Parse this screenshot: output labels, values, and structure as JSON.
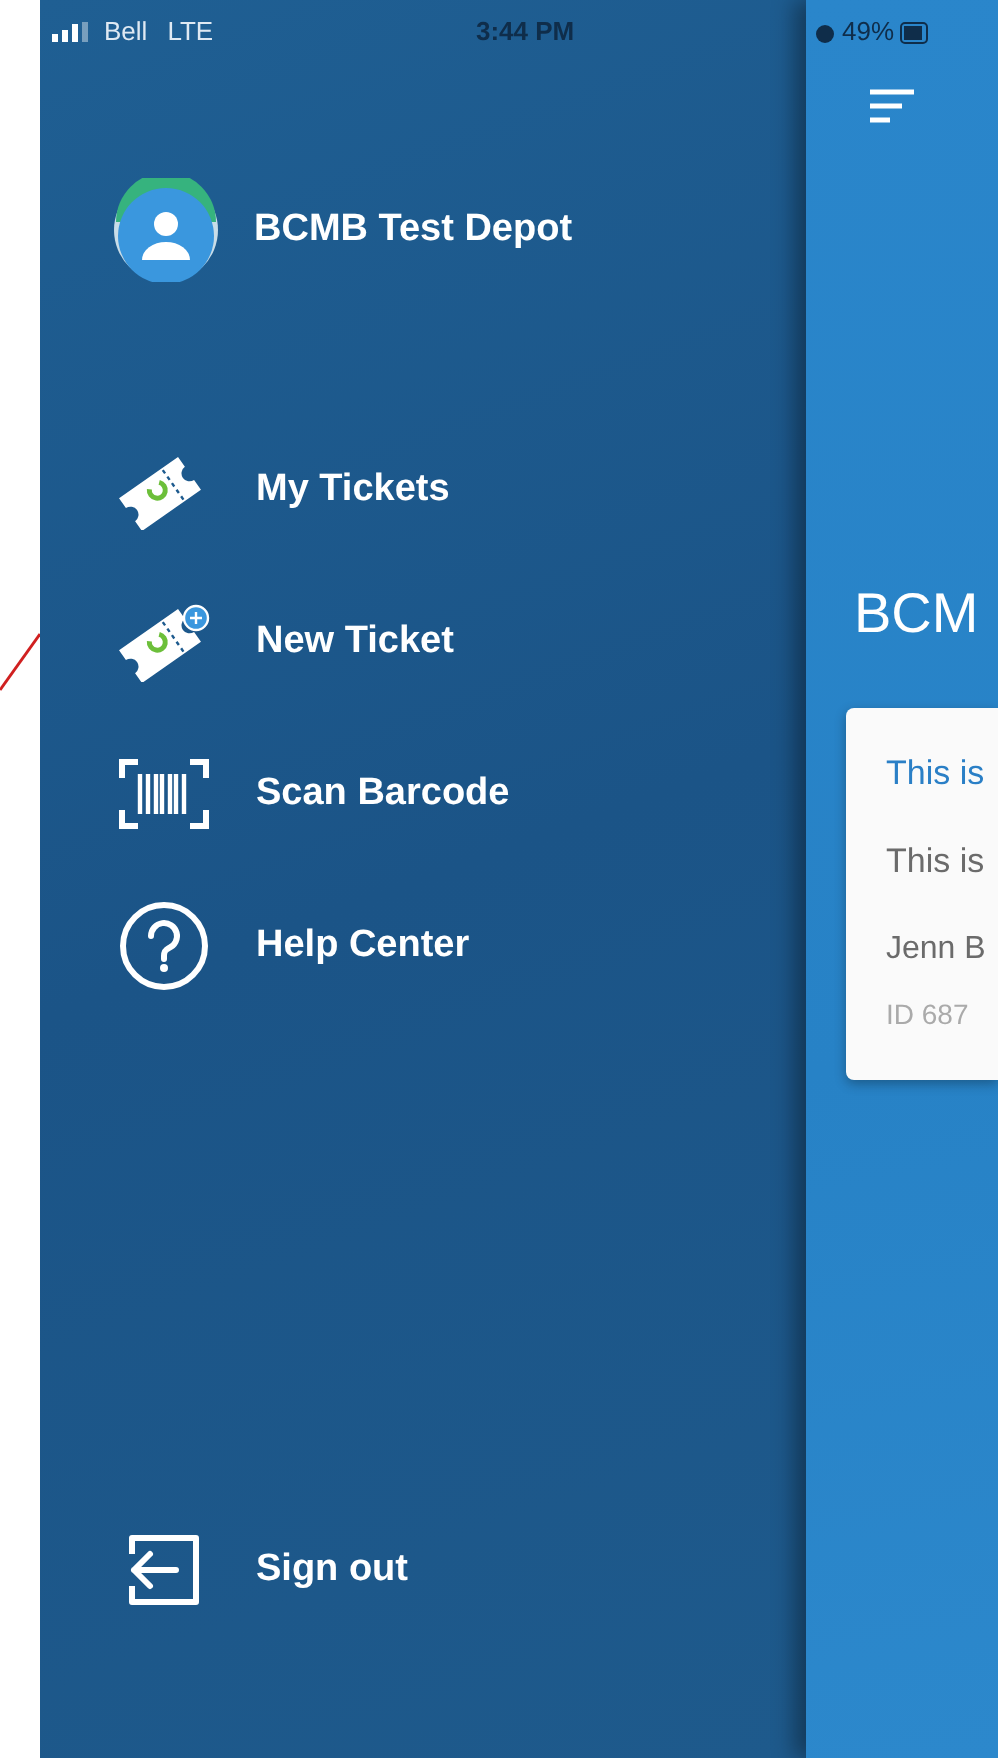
{
  "status_bar": {
    "carrier": "Bell",
    "network": "LTE",
    "time": "3:44 PM",
    "battery": "49%"
  },
  "drawer": {
    "account": "BCMB Test Depot",
    "items": [
      {
        "kind": "tickets",
        "label": "My Tickets"
      },
      {
        "kind": "new-ticket",
        "label": "New Ticket"
      },
      {
        "kind": "barcode",
        "label": "Scan Barcode"
      },
      {
        "kind": "help",
        "label": "Help Center"
      }
    ],
    "sign_out": "Sign out"
  },
  "main": {
    "title": "BCM",
    "card": {
      "title": "This is",
      "body": "This is",
      "author": "Jenn B",
      "id": "ID 687"
    }
  }
}
